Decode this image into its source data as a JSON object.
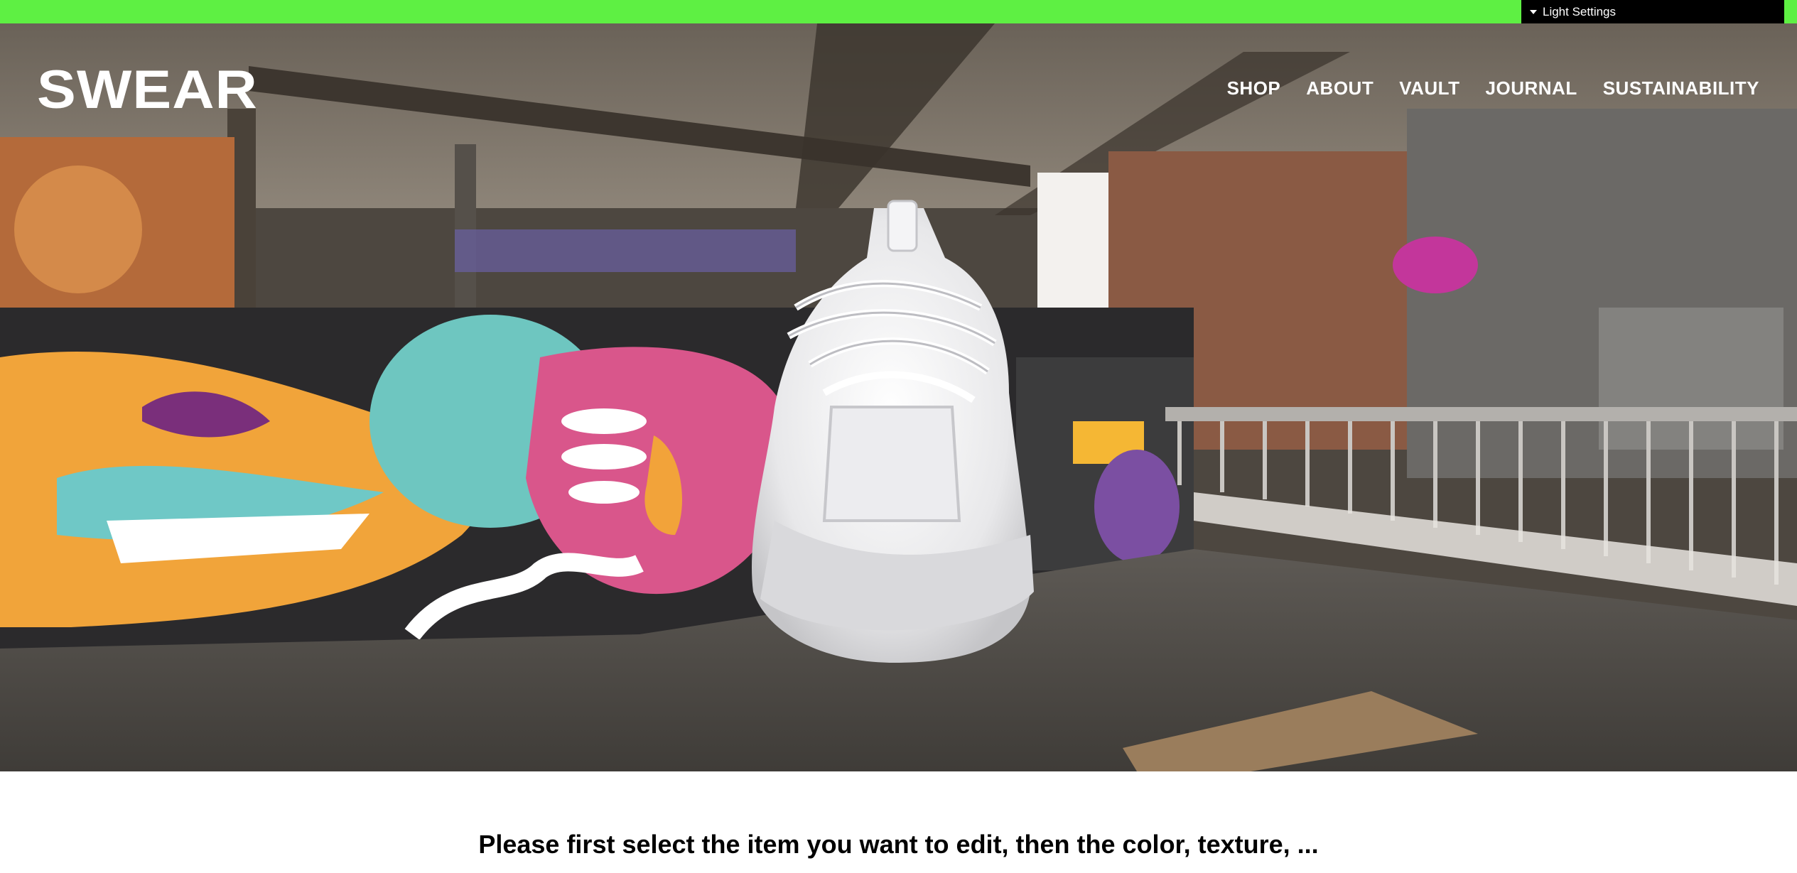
{
  "gui": {
    "panel_label": "Light Settings"
  },
  "header": {
    "logo_text": "SWEAR",
    "nav": [
      {
        "label": "SHOP"
      },
      {
        "label": "ABOUT"
      },
      {
        "label": "VAULT"
      },
      {
        "label": "JOURNAL"
      },
      {
        "label": "SUSTAINABILITY"
      }
    ]
  },
  "scene": {
    "description_icon": "sneaker-3d-model",
    "background_icon": "graffiti-warehouse-environment"
  },
  "main": {
    "instruction": "Please first select the item you want to edit, then the color, texture, ..."
  },
  "colors": {
    "accent_green": "#5ef043",
    "panel_black": "#000000",
    "nav_text": "#ffffff"
  }
}
